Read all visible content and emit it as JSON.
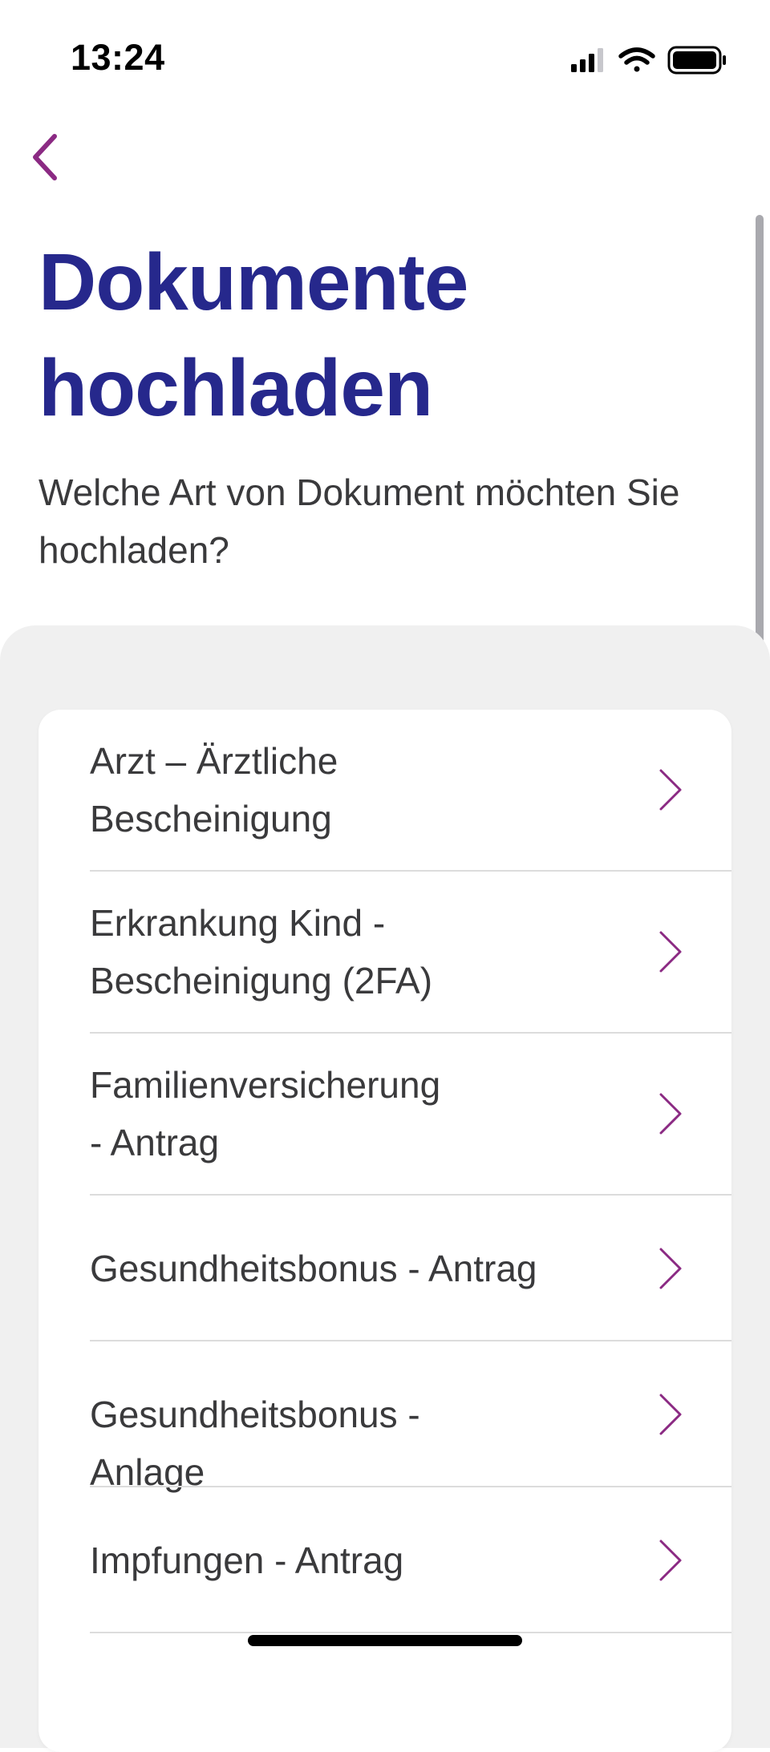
{
  "status_bar": {
    "time": "13:24",
    "icons": [
      "cellular-signal-icon",
      "wifi-icon",
      "battery-icon"
    ]
  },
  "nav": {
    "back_icon": "chevron-left-icon"
  },
  "page": {
    "title_line1": "Dokumente",
    "title_line2": "hochladen",
    "subtitle": "Welche Art von Dokument möchten Sie hochladen?"
  },
  "document_types": [
    {
      "line1": "Arzt – Ärztliche",
      "line2": "Bescheinigung"
    },
    {
      "line1": "Erkrankung Kind -",
      "line2": "Bescheinigung (2FA)"
    },
    {
      "line1": "Familienversicherung",
      "line2": "- Antrag"
    },
    {
      "line1": "Gesundheitsbonus - Antrag"
    },
    {
      "line1": "Gesundheitsbonus - Anlage"
    },
    {
      "line1": "Impfungen - Antrag"
    }
  ],
  "colors": {
    "title": "#26288c",
    "accent": "#8b2a83",
    "text": "#3a3a3c",
    "panel_background": "#f0f0f0"
  }
}
